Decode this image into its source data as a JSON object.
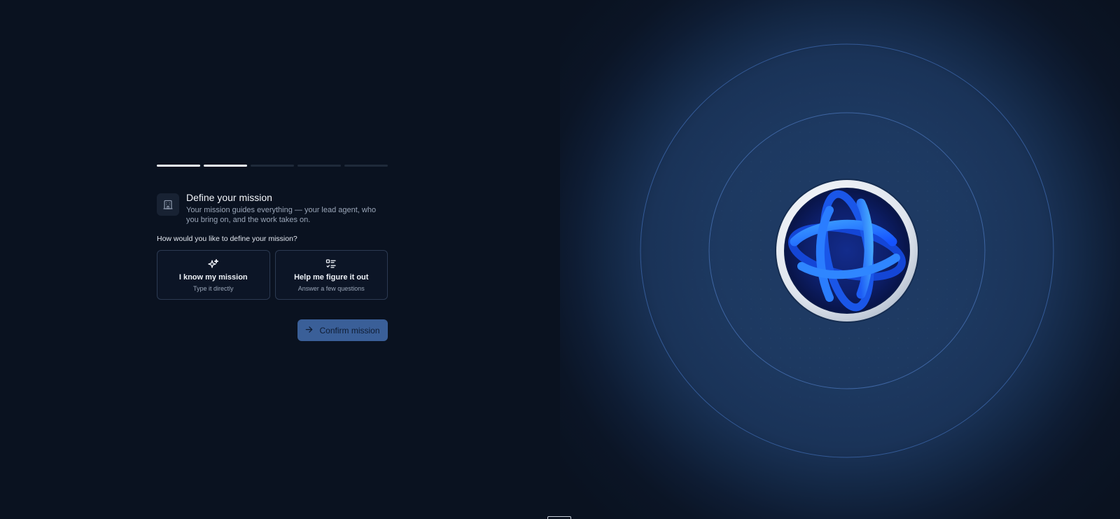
{
  "progress": {
    "total_steps": 5,
    "completed_steps": 2
  },
  "header": {
    "icon": "building-icon",
    "title": "Define your mission",
    "description": "Your mission guides everything — your lead agent, who you bring on, and the work takes on."
  },
  "question": "How would you like to define your mission?",
  "options": [
    {
      "icon": "sparkles-icon",
      "title": "I know my mission",
      "subtitle": "Type it directly"
    },
    {
      "icon": "checklist-icon",
      "title": "Help me figure it out",
      "subtitle": "Answer a few questions"
    }
  ],
  "confirm": {
    "icon": "arrow-right-icon",
    "label": "Confirm mission"
  },
  "visual": {
    "logo": "globe-logo",
    "accent": "#1e6bff"
  },
  "colors": {
    "background": "#0a1220",
    "button": "#3a5f98",
    "progress_done": "#f2f5fa",
    "progress_todo": "#1f2a3a"
  }
}
